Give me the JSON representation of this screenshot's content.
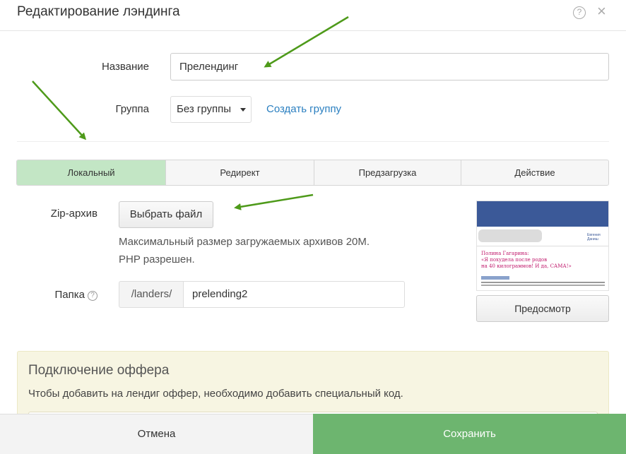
{
  "header": {
    "title": "Редактирование лэндинга",
    "help_icon": "?",
    "close_icon": "×"
  },
  "form": {
    "name_label": "Название",
    "name_value": "Прелендинг",
    "group_label": "Группа",
    "group_value": "Без группы",
    "create_group_link": "Создать группу"
  },
  "tabs": [
    {
      "label": "Локальный",
      "active": true
    },
    {
      "label": "Редирект",
      "active": false
    },
    {
      "label": "Предзагрузка",
      "active": false
    },
    {
      "label": "Действие",
      "active": false
    }
  ],
  "local": {
    "zip_label": "Zip-архив",
    "choose_file": "Выбрать файл",
    "hint_line1": "Максимальный размер загружаемых архивов 20M.",
    "hint_line2": "PHP разрешен.",
    "folder_label": "Папка",
    "folder_help": "?",
    "folder_prefix": "/landers/",
    "folder_value": "prelending2"
  },
  "preview": {
    "button": "Предосмотр",
    "thumb_link": "Евгения Даниш",
    "thumb_heading_line1": "Полина Гагарина:",
    "thumb_heading_line2": "«Я похудела после родов",
    "thumb_heading_line3": "на 40 килограммов! И да, САМА!»"
  },
  "offer": {
    "title": "Подключение оффера",
    "text": "Чтобы добавить на лендиг оффер, необходимо добавить специальный код."
  },
  "footer": {
    "cancel": "Отмена",
    "save": "Сохранить"
  },
  "colors": {
    "active_tab": "#c3e6c5",
    "save_button": "#6db56f",
    "link": "#2a7fc0",
    "annotation_arrow": "#4e9a1a",
    "offer_panel": "#f7f5e2"
  }
}
